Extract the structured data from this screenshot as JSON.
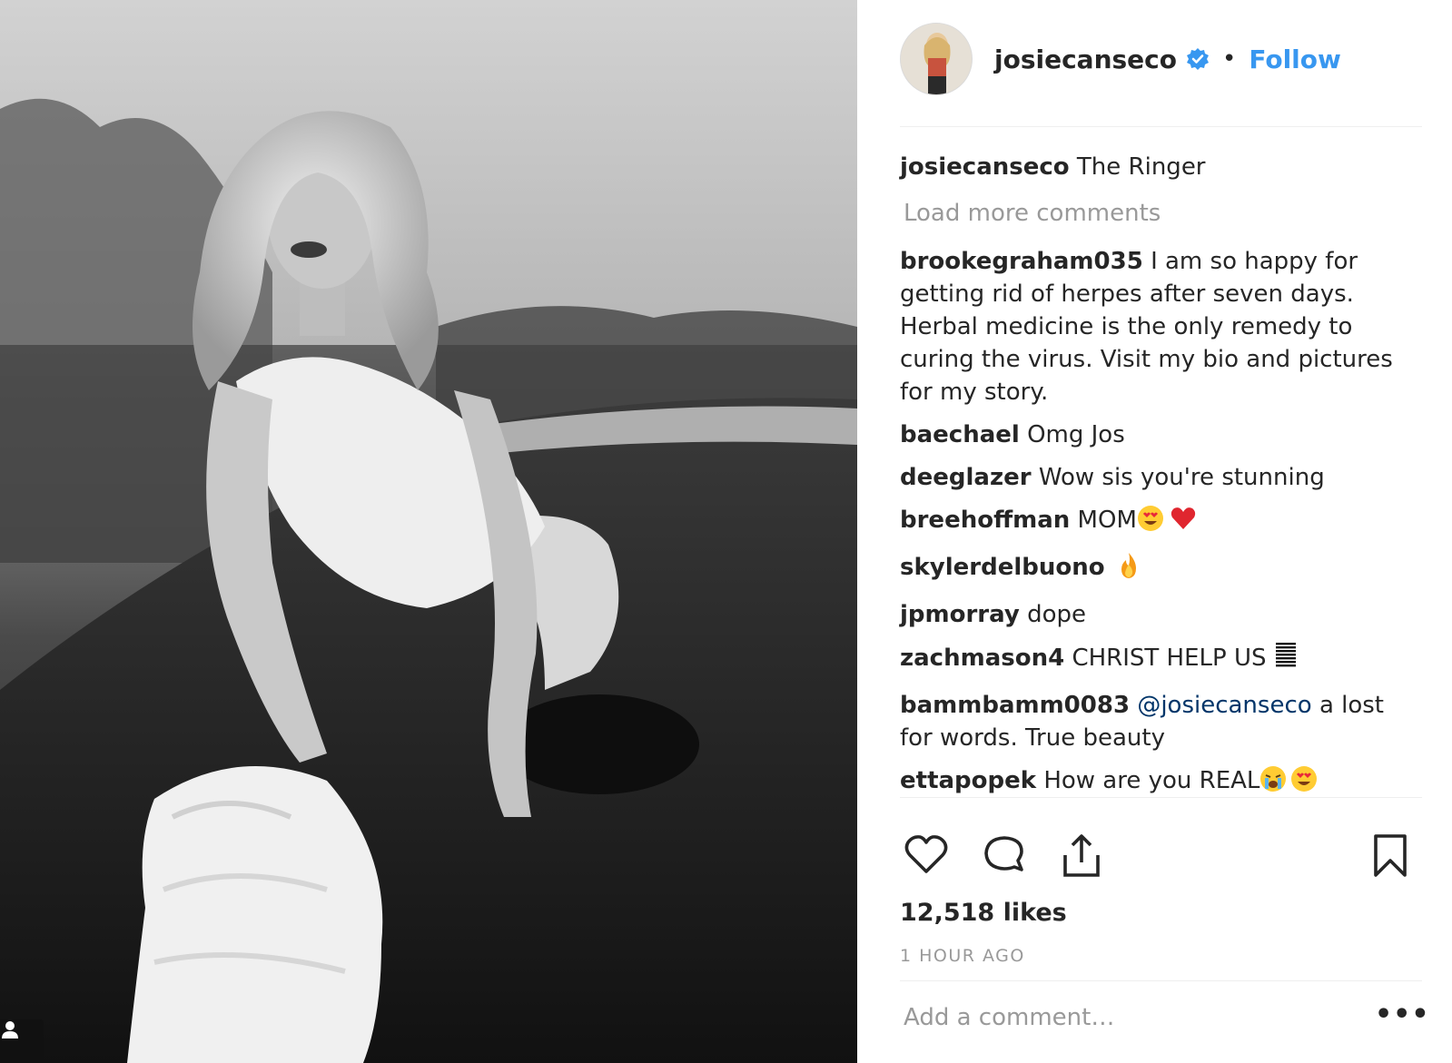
{
  "post": {
    "username": "josiecanseco",
    "follow_label": "Follow",
    "separator": "•",
    "caption_user": "josiecanseco",
    "caption_text": "The Ringer",
    "load_more_label": "Load more comments",
    "comments": [
      {
        "user": "brookegraham035",
        "text": "I am so happy for getting rid of herpes after seven days. Herbal medicine is the only remedy to curing the virus. Visit my bio and pictures for my story."
      },
      {
        "user": "baechael",
        "text": "Omg Jos"
      },
      {
        "user": "deeglazer",
        "text": "Wow sis you're stunning"
      },
      {
        "user": "breehoffman",
        "text": "MOM"
      },
      {
        "user": "skylerdelbuono",
        "text": ""
      },
      {
        "user": "jpmorray",
        "text": "dope"
      },
      {
        "user": "zachmason4",
        "text": "CHRIST HELP US"
      },
      {
        "user": "bammbamm0083",
        "mention": "@josiecanseco",
        "text": "a lost for words. True beauty"
      },
      {
        "user": "ettapopek",
        "text": "How are you REAL"
      }
    ],
    "likes": "12,518 likes",
    "timestamp": "1 HOUR AGO",
    "add_comment_placeholder": "Add a comment…",
    "more_label": "•••"
  },
  "icons": {
    "verified": "verified-badge-icon",
    "like": "heart-icon",
    "comment": "comment-bubble-icon",
    "share": "share-icon",
    "save": "bookmark-icon",
    "tag": "user-tag-icon",
    "emoji_heart_eyes": "heart-eyes-emoji",
    "emoji_red_heart": "red-heart-emoji",
    "emoji_fire": "fire-emoji",
    "emoji_praying": "praying-hands-emoji",
    "emoji_crying": "crying-emoji"
  },
  "colors": {
    "link_blue": "#3897f0",
    "mention_blue": "#003569",
    "muted_gray": "#999999",
    "text": "#262626"
  }
}
